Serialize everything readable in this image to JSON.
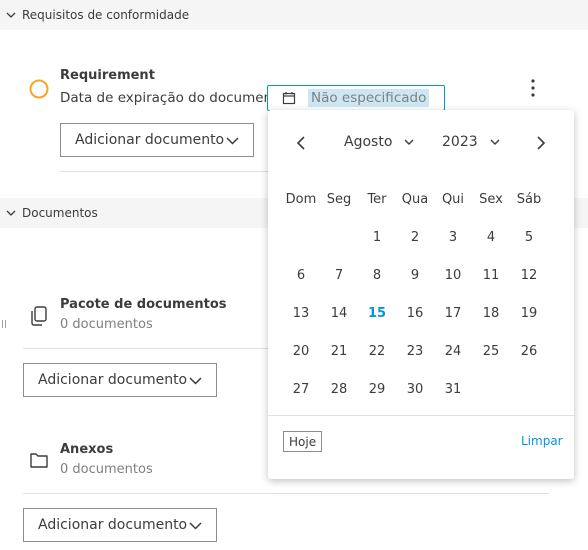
{
  "sections": {
    "compliance_title": "Requisitos de conformidade",
    "documents_title": "Documentos"
  },
  "requirement": {
    "title": "Requirement",
    "expiry_label": "Data de expiração do documento:",
    "expiry_value": "Não especificado",
    "add_button": "Adicionar documento",
    "status_color": "#f5a623"
  },
  "packages": {
    "title": "Pacote de documentos",
    "count": "0 documentos",
    "add_button": "Adicionar documento"
  },
  "attachments": {
    "title": "Anexos",
    "count": "0 documentos",
    "add_button": "Adicionar documento"
  },
  "calendar": {
    "month": "Agosto",
    "year": "2023",
    "weekdays": [
      "Dom",
      "Seg",
      "Ter",
      "Qua",
      "Qui",
      "Sex",
      "Sáb"
    ],
    "weeks": [
      [
        "",
        "",
        "1",
        "2",
        "3",
        "4",
        "5"
      ],
      [
        "6",
        "7",
        "8",
        "9",
        "10",
        "11",
        "12"
      ],
      [
        "13",
        "14",
        "15",
        "16",
        "17",
        "18",
        "19"
      ],
      [
        "20",
        "21",
        "22",
        "23",
        "24",
        "25",
        "26"
      ],
      [
        "27",
        "28",
        "29",
        "30",
        "31",
        "",
        ""
      ]
    ],
    "today": "15",
    "today_button": "Hoje",
    "clear_button": "Limpar",
    "accent_color": "#0696d7"
  },
  "icons": {
    "collapse": "chevron-down-icon",
    "calendar": "calendar-icon",
    "more": "more-vertical-icon",
    "prev": "chevron-left-icon",
    "next": "chevron-right-icon",
    "package": "document-package-icon",
    "folder": "folder-icon",
    "status": "status-circle-icon"
  }
}
